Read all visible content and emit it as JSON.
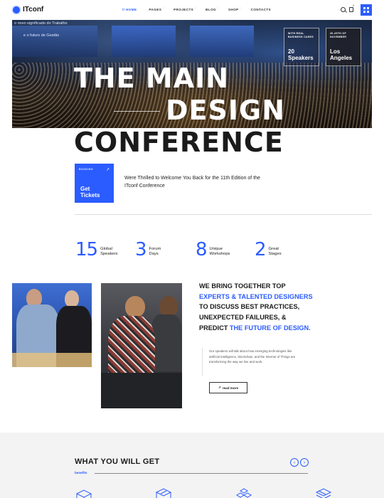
{
  "header": {
    "logo_text": "ITconf",
    "nav": [
      {
        "label": "HOME",
        "prefix": "// ",
        "active": true
      },
      {
        "label": "PAGES",
        "active": false
      },
      {
        "label": "PROJECTS",
        "active": false
      },
      {
        "label": "BLOG",
        "active": false
      },
      {
        "label": "SHOP",
        "active": false
      },
      {
        "label": "CONTACTS",
        "active": false
      }
    ],
    "cart_count": "0",
    "accent": "#2b5cff"
  },
  "hero": {
    "screen_left_line1": "o novo significado do Trabalho",
    "screen_left_line2": "e o futuro de Gestão",
    "box1_small": "WITH REAL BUSINESS CASES",
    "box1_big": "20 Speakers",
    "box2_small": "20-29TH OF NOVEMBER",
    "box2_big": "Los Angeles",
    "headline_1": "THE MAIN",
    "headline_2": "DESIGN",
    "headline_3": "CONFERENCE"
  },
  "booking": {
    "kicker": "BOOKING",
    "label": "Get Tickets",
    "welcome": "Were Thrilled to Welcome You Back for the 11th Edition of the ITconf Conference"
  },
  "stats": [
    {
      "num": "15",
      "label": "Global Speakers"
    },
    {
      "num": "3",
      "label": "Forum Days"
    },
    {
      "num": "8",
      "label": "Unique Workshops"
    },
    {
      "num": "2",
      "label": "Great Stages"
    }
  ],
  "pitch": {
    "part1": "WE BRING TOGETHER TOP ",
    "part2": "EXPERTS & TALENTED DESIGNERS",
    "part3": " TO DISCUSS BEST PRACTICES, UNEXPECTED FAILURES, & PREDICT ",
    "part4": "THE FUTURE OF DESIGN.",
    "note": "Our speakers will talk about how emerging technologies like artificial intelligence, blockchain, and the Internet of Things are transforming the way we live and work.",
    "read_more": "read more"
  },
  "bottom": {
    "title": "WHAT YOU WILL GET",
    "kicker": "benefits",
    "prev": "‹",
    "next": "›"
  }
}
